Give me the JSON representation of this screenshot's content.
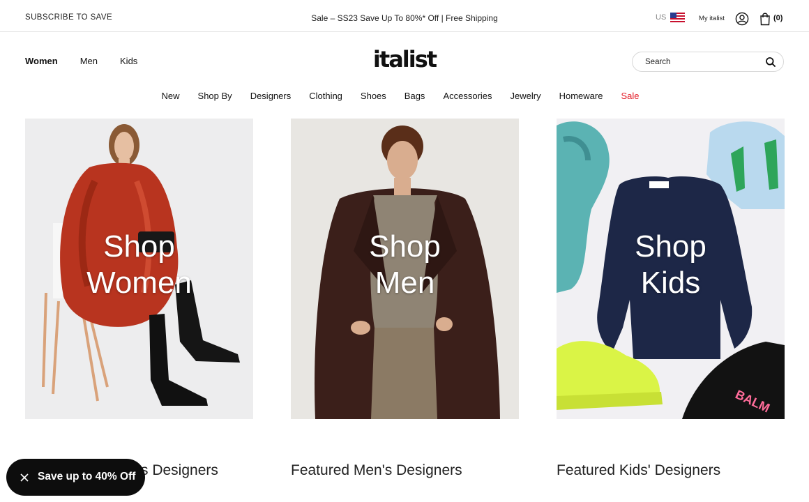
{
  "topbar": {
    "subscribe": "SUBSCRIBE TO SAVE",
    "promo": "Sale – SS23 Save Up To 80%* Off | Free Shipping",
    "region_code": "US",
    "my_italist": "My italist",
    "bag_count": "(0)"
  },
  "header": {
    "gender_nav": [
      "Women",
      "Men",
      "Kids"
    ],
    "logo": "italist",
    "search_placeholder": "Search"
  },
  "category_nav": [
    "New",
    "Shop By",
    "Designers",
    "Clothing",
    "Shoes",
    "Bags",
    "Accessories",
    "Jewelry",
    "Homeware",
    "Sale"
  ],
  "cards": [
    {
      "line1": "Shop",
      "line2": "Women"
    },
    {
      "line1": "Shop",
      "line2": "Men"
    },
    {
      "line1": "Shop",
      "line2": "Kids"
    }
  ],
  "sections": {
    "women_partial": "s Designers",
    "men": "Featured Men's Designers",
    "kids": "Featured Kids' Designers"
  },
  "promo_pill": "Save up to 40% Off",
  "colors": {
    "sale_red": "#e4202b",
    "pill_bg": "#0d0d0d"
  }
}
